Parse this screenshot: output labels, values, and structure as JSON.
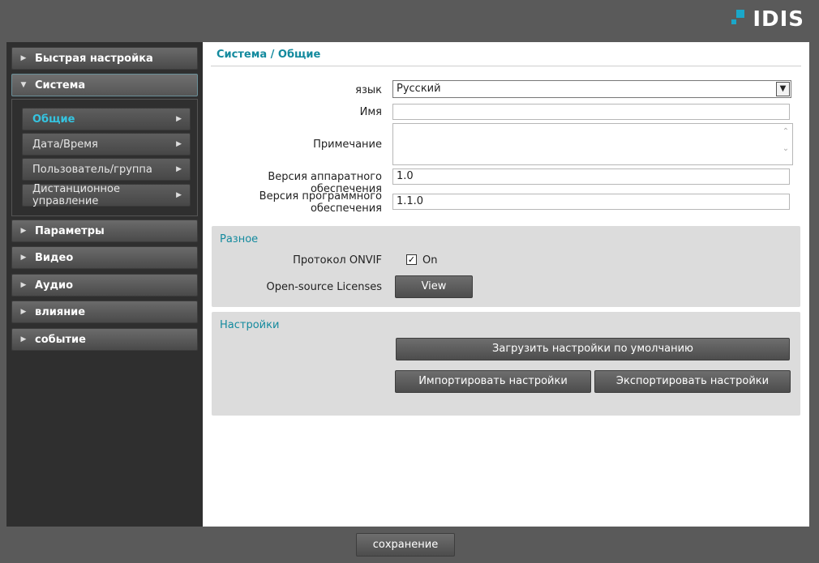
{
  "brand": {
    "logo_text": "IDIS",
    "accent": "#1aa7c9"
  },
  "sidebar": {
    "items": [
      {
        "label": "Быстрая настройка"
      },
      {
        "label": "Система"
      },
      {
        "label": "Параметры"
      },
      {
        "label": "Видео"
      },
      {
        "label": "Аудио"
      },
      {
        "label": "влияние"
      },
      {
        "label": "событие"
      }
    ],
    "submenu": [
      {
        "label": "Общие"
      },
      {
        "label": "Дата/Время"
      },
      {
        "label": "Пользователь/группа"
      },
      {
        "label": "Дистанционное управление"
      }
    ]
  },
  "main": {
    "title": "Система / Общие",
    "form": {
      "language_label": "язык",
      "language_value": "Русский",
      "name_label": "Имя",
      "name_value": "",
      "note_label": "Примечание",
      "note_value": "",
      "hw_version_label": "Версия аппаратного обеспечения",
      "hw_version_value": "1.0",
      "sw_version_label": "Версия программного обеспечения",
      "sw_version_value": "1.1.0"
    },
    "misc": {
      "title": "Разное",
      "onvif_label": "Протокол ONVIF",
      "onvif_checked": true,
      "onvif_value": "On",
      "licenses_label": "Open-source Licenses",
      "view_button": "View"
    },
    "settings": {
      "title": "Настройки",
      "load_default_button": "Загрузить настройки по умолчанию",
      "import_button": "Импортировать настройки",
      "export_button": "Экспортировать настройки"
    }
  },
  "footer": {
    "save_button": "сохранение"
  }
}
